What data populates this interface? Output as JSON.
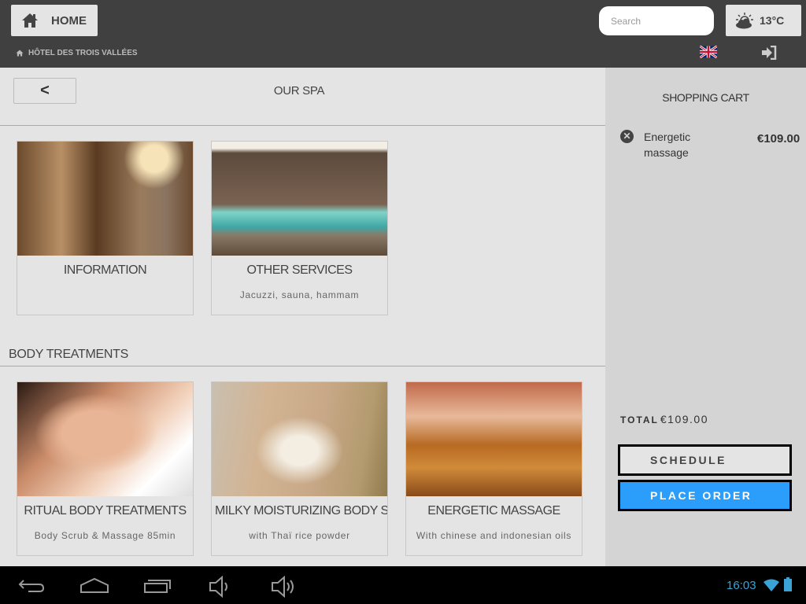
{
  "header": {
    "home_label": "HOME",
    "breadcrumb": "HÔTEL DES TROIS VALLÉES",
    "search_placeholder": "Search",
    "weather": "13°C",
    "language": "English (UK flag)"
  },
  "page": {
    "back_label": "<",
    "title": "OUR SPA"
  },
  "cards": [
    {
      "title": "INFORMATION",
      "subtitle": ""
    },
    {
      "title": "OTHER SERVICES",
      "subtitle": "Jacuzzi, sauna, hammam"
    }
  ],
  "section": {
    "title": "BODY TREATMENTS"
  },
  "treatments": [
    {
      "title": "RITUAL BODY TREATMENTS",
      "subtitle": "Body Scrub & Massage 85min"
    },
    {
      "title": "MILKY MOISTURIZING BODY SCRUB",
      "subtitle": "with Thaï rice powder"
    },
    {
      "title": "ENERGETIC MASSAGE",
      "subtitle": "With chinese and indonesian oils"
    }
  ],
  "cart": {
    "title": "SHOPPING CART",
    "items": [
      {
        "name": "Energetic massage",
        "price": "€109.00"
      }
    ],
    "total_label": "TOTAL",
    "total": "€109.00",
    "schedule_label": "SCHEDULE",
    "order_label": "PLACE ORDER"
  },
  "status": {
    "time": "16:03"
  },
  "colors": {
    "accent": "#2b9dfa",
    "topbar": "#404040",
    "status": "#3aa3d6"
  }
}
